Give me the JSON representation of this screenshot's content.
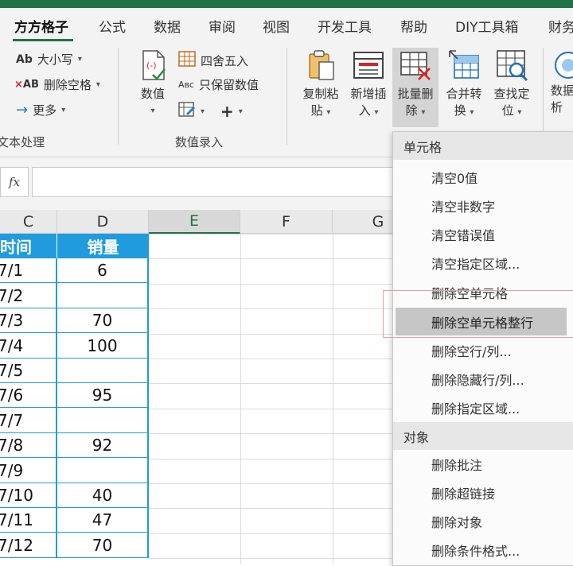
{
  "tabs": [
    "方方格子",
    "公式",
    "数据",
    "审阅",
    "视图",
    "开发工具",
    "帮助",
    "DIY工具箱",
    "财务"
  ],
  "ribbon": {
    "text_group": {
      "case_label": "大小写",
      "delete_space_label": "删除空格",
      "more_label": "更多",
      "group_label": "文本处理"
    },
    "number_group": {
      "value_label": "数值",
      "round_label": "四舍五入",
      "keep_value_label": "只保留数值",
      "group_label": "数值录入"
    },
    "buttons": {
      "copy_paste": [
        "复制粘",
        "贴"
      ],
      "insert_new": [
        "新增插",
        "入"
      ],
      "batch_delete": [
        "批量删",
        "除"
      ],
      "merge_convert": [
        "合并转",
        "换"
      ],
      "find_locate": [
        "查找定",
        "位"
      ],
      "data_analysis": [
        "数据",
        "析"
      ]
    }
  },
  "formula_bar": {
    "fx_label": "fx",
    "value": ""
  },
  "columns": [
    "C",
    "D",
    "E",
    "F",
    "G"
  ],
  "table": {
    "headers": [
      "时间",
      "销量"
    ],
    "rows": [
      [
        "7/1",
        "6"
      ],
      [
        "7/2",
        ""
      ],
      [
        "7/3",
        "70"
      ],
      [
        "7/4",
        "100"
      ],
      [
        "7/5",
        ""
      ],
      [
        "7/6",
        "95"
      ],
      [
        "7/7",
        ""
      ],
      [
        "7/8",
        "92"
      ],
      [
        "7/9",
        ""
      ],
      [
        "7/10",
        "40"
      ],
      [
        "7/11",
        "47"
      ],
      [
        "7/12",
        "70"
      ]
    ],
    "header_bg": "#1f9bde",
    "border_color": "#1f9bde"
  },
  "menu": {
    "section1": "单元格",
    "items1": [
      "清空0值",
      "清空非数字",
      "清空错误值",
      "清空指定区域...",
      "删除空单元格",
      "删除空单元格整行",
      "删除空行/列...",
      "删除隐藏行/列...",
      "删除指定区域..."
    ],
    "highlighted": "删除空单元格整行",
    "section2": "对象",
    "items2": [
      "删除批注",
      "删除超链接",
      "删除对象",
      "删除条件格式..."
    ]
  },
  "colors": {
    "excel_green": "#217346",
    "accent_red": "#e02020",
    "accent_blue": "#1f9bde"
  }
}
